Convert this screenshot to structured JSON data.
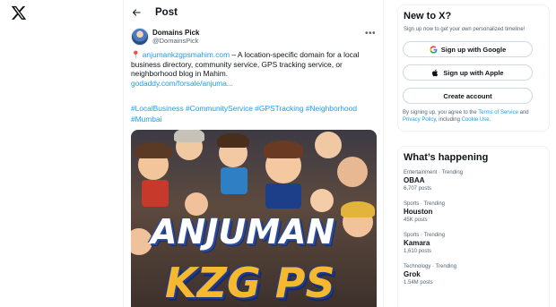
{
  "header": {
    "title": "Post"
  },
  "tweet": {
    "author_name": "Domains Pick",
    "author_handle": "@DomainsPick",
    "pin_emoji": "📍",
    "domain_link": "anjumankzgpsmahim.com",
    "body": " – A location-specific domain for a local business directory, community service, GPS tracking service, or neighborhood blog in Mahim.",
    "url": "godaddy.com/forsale/anjuma...",
    "hashtags": [
      "#LocalBusiness",
      "#CommunityService",
      "#GPSTracking",
      "#Neighborhood",
      "#Mumbai"
    ],
    "image_words": [
      "ANJUMAN",
      "KZG PS"
    ]
  },
  "signup": {
    "title": "New to X?",
    "subtitle": "Sign up now to get your own personalized timeline!",
    "google_label": "Sign up with Google",
    "apple_label": "Sign up with Apple",
    "create_label": "Create account",
    "terms_prefix": "By signing up, you agree to the ",
    "terms_link": "Terms of Service",
    "terms_and": " and ",
    "privacy_link": "Privacy Policy",
    "terms_including": ", including ",
    "cookie_link": "Cookie Use",
    "terms_end": "."
  },
  "trends": {
    "title": "What’s happening",
    "items": [
      {
        "meta": "Entertainment · Trending",
        "name": "OBAA",
        "count": "6,707 posts"
      },
      {
        "meta": "Sports · Trending",
        "name": "Houston",
        "count": "45K posts"
      },
      {
        "meta": "Sports · Trending",
        "name": "Kamara",
        "count": "1,610 posts"
      },
      {
        "meta": "Technology · Trending",
        "name": "Grok",
        "count": "1.54M posts"
      }
    ]
  },
  "colors": {
    "link": "#1d9bf0",
    "text": "#0f1419",
    "muted": "#536471",
    "border": "#eff3f4"
  },
  "icons": [
    "x-logo-icon",
    "back-arrow-icon",
    "more-icon",
    "pin-icon",
    "google-icon",
    "apple-icon"
  ]
}
